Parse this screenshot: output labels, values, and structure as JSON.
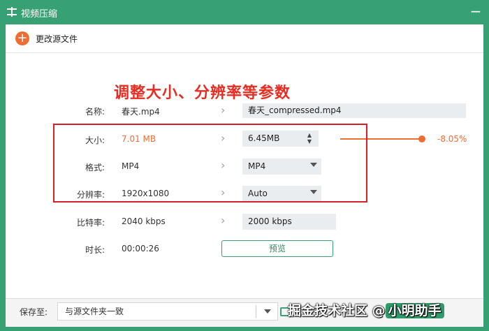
{
  "window": {
    "title": "视频压缩",
    "minimize_glyph": "−"
  },
  "toolbar": {
    "change_source_label": "更改源文件",
    "add_icon_glyph": "+"
  },
  "annotation": {
    "heading": "调整大小、分辨率等参数"
  },
  "rows": {
    "name": {
      "label": "名称:",
      "source": "春天.mp4",
      "target": "春天_compressed.mp4"
    },
    "size": {
      "label": "大小:",
      "source": "7.01 MB",
      "target": "6.45MB",
      "percent": "-8.05%",
      "slider_level": 0.805
    },
    "format": {
      "label": "格式:",
      "source": "MP4",
      "selected": "MP4"
    },
    "resolution": {
      "label": "分辨率:",
      "source": "1920x1080",
      "selected": "Auto"
    },
    "bitrate": {
      "label": "比特率:",
      "source": "2040 kbps",
      "target": "2000 kbps"
    },
    "duration": {
      "label": "时长:",
      "source": "00:00:26"
    }
  },
  "preview_button": "预览",
  "footer": {
    "save_to_label": "保存至:",
    "save_location": "与源文件夹一致"
  },
  "watermark": {
    "text": "掘金技术社区 @",
    "tag": "小明助手"
  },
  "colors": {
    "brand_green": "#38a173",
    "accent_orange": "#ef6d32",
    "annotation_red": "#e82c22"
  },
  "icons": [
    "app-icon",
    "minimize-icon",
    "add-icon",
    "chevron-right-icon",
    "caret-up-icon",
    "caret-down-icon",
    "dropdown-arrow-icon",
    "folder-icon"
  ]
}
